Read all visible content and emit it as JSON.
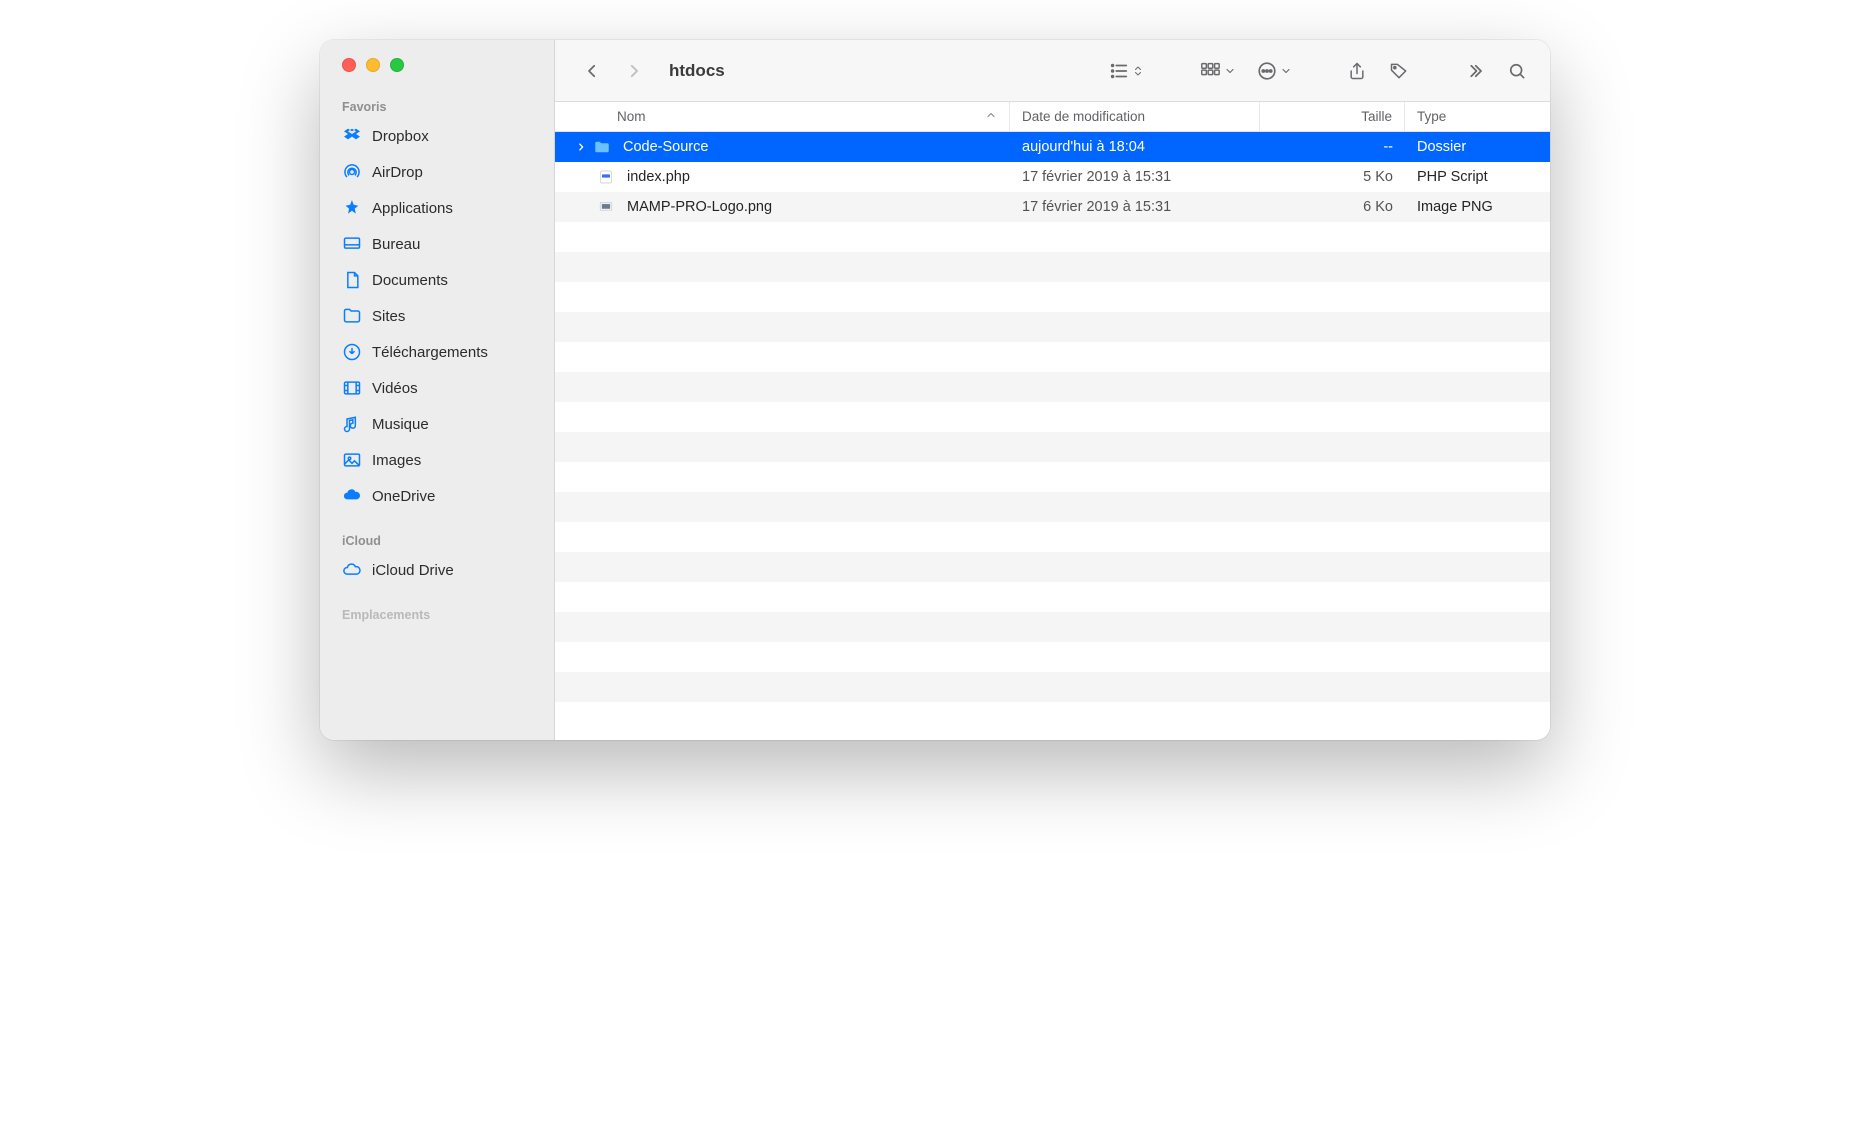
{
  "window_title": "htdocs",
  "sidebar": {
    "sections": [
      {
        "label": "Favoris",
        "items": [
          {
            "icon": "dropbox",
            "label": "Dropbox"
          },
          {
            "icon": "airdrop",
            "label": "AirDrop"
          },
          {
            "icon": "applications",
            "label": "Applications"
          },
          {
            "icon": "desktop",
            "label": "Bureau"
          },
          {
            "icon": "documents",
            "label": "Documents"
          },
          {
            "icon": "folder",
            "label": "Sites"
          },
          {
            "icon": "downloads",
            "label": "Téléchargements"
          },
          {
            "icon": "movies",
            "label": "Vidéos"
          },
          {
            "icon": "music",
            "label": "Musique"
          },
          {
            "icon": "pictures",
            "label": "Images"
          },
          {
            "icon": "onedrive",
            "label": "OneDrive"
          }
        ]
      },
      {
        "label": "iCloud",
        "items": [
          {
            "icon": "icloud",
            "label": "iCloud Drive"
          }
        ]
      },
      {
        "label": "Emplacements",
        "items": []
      }
    ]
  },
  "columns": {
    "name": "Nom",
    "date": "Date de modification",
    "size": "Taille",
    "type": "Type"
  },
  "rows": [
    {
      "name": "Code-Source",
      "date": "aujourd'hui à 18:04",
      "size": "--",
      "type": "Dossier",
      "kind": "folder",
      "selected": true,
      "expandable": true
    },
    {
      "name": "index.php",
      "date": "17 février 2019 à 15:31",
      "size": "5 Ko",
      "type": "PHP Script",
      "kind": "php",
      "selected": false,
      "expandable": false
    },
    {
      "name": "MAMP-PRO-Logo.png",
      "date": "17 février 2019 à 15:31",
      "size": "6 Ko",
      "type": "Image PNG",
      "kind": "png",
      "selected": false,
      "expandable": false
    }
  ],
  "colors": {
    "selection": "#0066ff",
    "accent": "#0a7eff"
  }
}
